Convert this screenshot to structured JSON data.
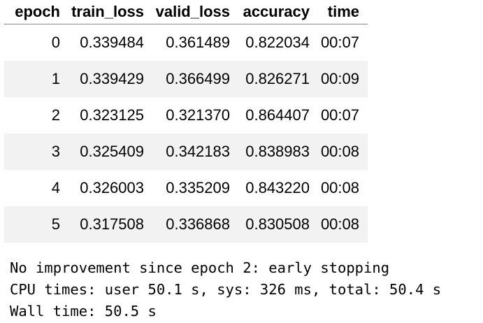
{
  "table": {
    "columns": [
      "epoch",
      "train_loss",
      "valid_loss",
      "accuracy",
      "time"
    ],
    "rows": [
      [
        "0",
        "0.339484",
        "0.361489",
        "0.822034",
        "00:07"
      ],
      [
        "1",
        "0.339429",
        "0.366499",
        "0.826271",
        "00:09"
      ],
      [
        "2",
        "0.323125",
        "0.321370",
        "0.864407",
        "00:07"
      ],
      [
        "3",
        "0.325409",
        "0.342183",
        "0.838983",
        "00:08"
      ],
      [
        "4",
        "0.326003",
        "0.335209",
        "0.843220",
        "00:08"
      ],
      [
        "5",
        "0.317508",
        "0.336868",
        "0.830508",
        "00:08"
      ]
    ]
  },
  "output": {
    "lines": [
      "No improvement since epoch 2: early stopping",
      "CPU times: user 50.1 s, sys: 326 ms, total: 50.4 s",
      "Wall time: 50.5 s"
    ]
  },
  "colors": {
    "stripe": "#f2f2f2",
    "header_rule": "#8a8a8a",
    "text": "#000000"
  }
}
